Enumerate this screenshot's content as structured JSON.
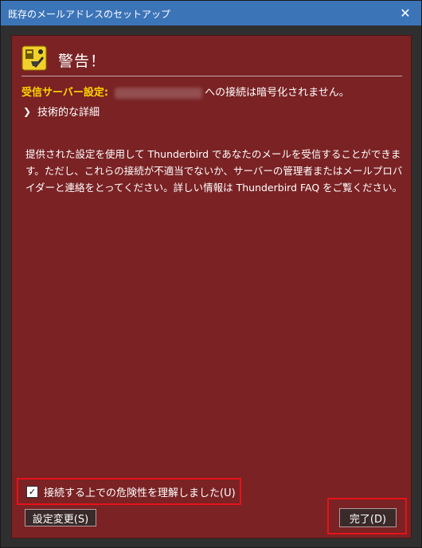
{
  "window": {
    "title": "既存のメールアドレスのセットアップ",
    "close_glyph": "✕"
  },
  "warning": {
    "heading": "警告！",
    "server_label": "受信サーバー設定:",
    "server_message": "への接続は暗号化されません。",
    "details_toggle": "技術的な詳細",
    "body": "提供された設定を使用して Thunderbird であなたのメールを受信することができます。ただし、これらの接続が不適当でないか、サーバーの管理者またはメールプロバイダーと連絡をとってください。詳しい情報は Thunderbird FAQ をご覧ください。"
  },
  "checkbox": {
    "label": "接続する上での危険性を理解しました(U)",
    "checked": true
  },
  "buttons": {
    "change_settings": "設定変更(S)",
    "done": "完了(D)"
  },
  "icons": {
    "warning": "warning-icon",
    "chevron": "chevron-right-icon",
    "close": "close-icon",
    "check": "check-icon"
  },
  "colors": {
    "titlebar": "#3c74b8",
    "panel": "#7a2224",
    "server_label": "#ffd400",
    "highlight": "#e8121a"
  }
}
